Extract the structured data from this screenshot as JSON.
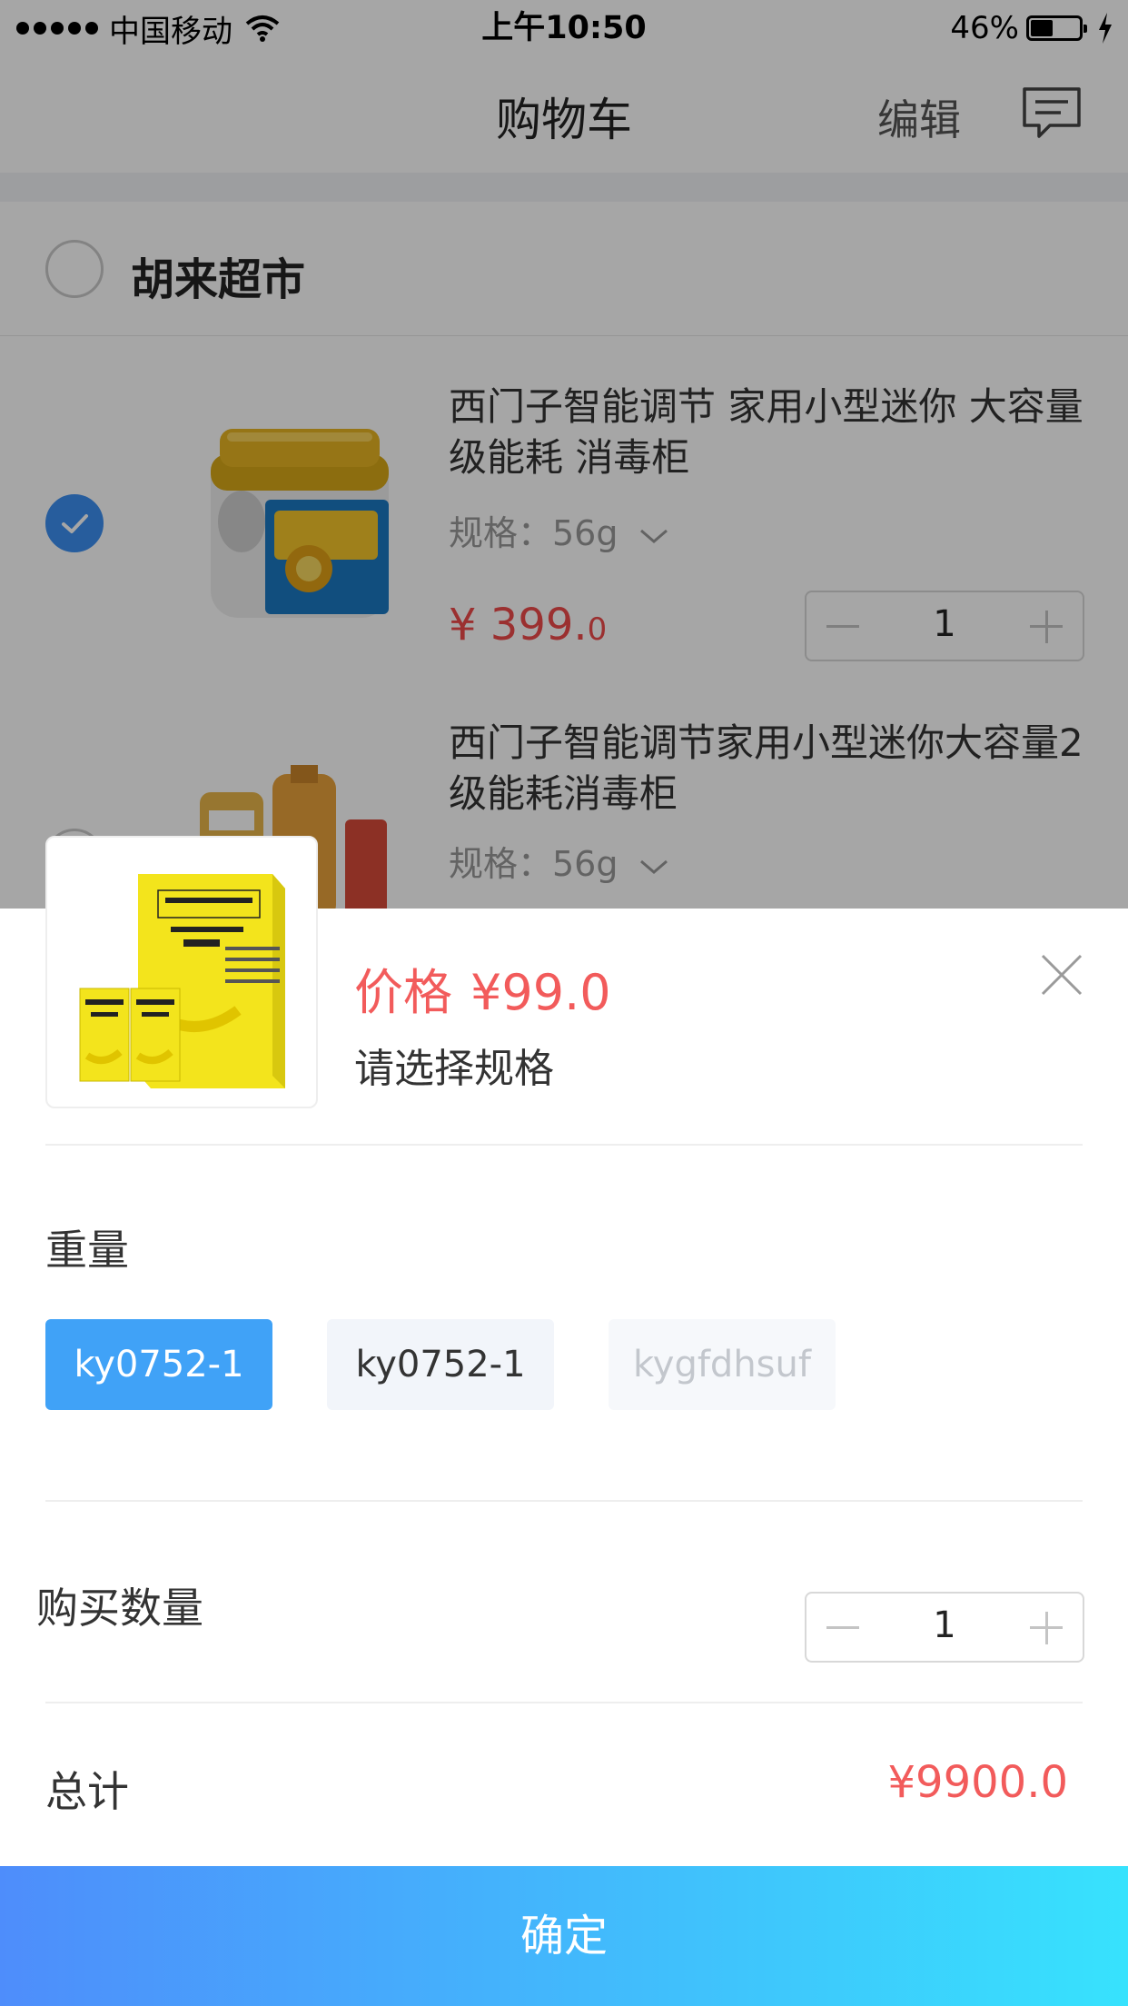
{
  "status_bar": {
    "carrier": "中国移动",
    "time": "上午10:50",
    "battery_percent": "46%",
    "battery_level": 0.46
  },
  "nav": {
    "title": "购物车",
    "edit": "编辑",
    "message_icon": "message-icon"
  },
  "store": {
    "name": "胡来超市",
    "checked": false
  },
  "items": [
    {
      "name": "西门子智能调节 家用小型迷你 大容量级能耗 消毒柜",
      "spec": "规格：56g",
      "price_main": "¥ 399.",
      "price_decimal": "0",
      "quantity": "1",
      "checked": true
    },
    {
      "name": "西门子智能调节家用小型迷你大容量2级能耗消毒柜",
      "spec": "规格：56g",
      "checked": false
    }
  ],
  "sheet": {
    "price_label": "价格",
    "price_value": "¥99.0",
    "hint": "请选择规格",
    "weight_title": "重量",
    "options": [
      {
        "label": "ky0752-1",
        "state": "selected"
      },
      {
        "label": "ky0752-1",
        "state": "normal"
      },
      {
        "label": "kygfdhsuf",
        "state": "disabled"
      }
    ],
    "quantity_title": "购买数量",
    "quantity": "1",
    "total_label": "总计",
    "total_value": "¥9900.0",
    "confirm": "确定"
  },
  "colors": {
    "accent_blue": "#40a2f7",
    "price_red": "#f25b5b",
    "gradient_start": "#4e8dfb",
    "gradient_end": "#37e2fd"
  }
}
